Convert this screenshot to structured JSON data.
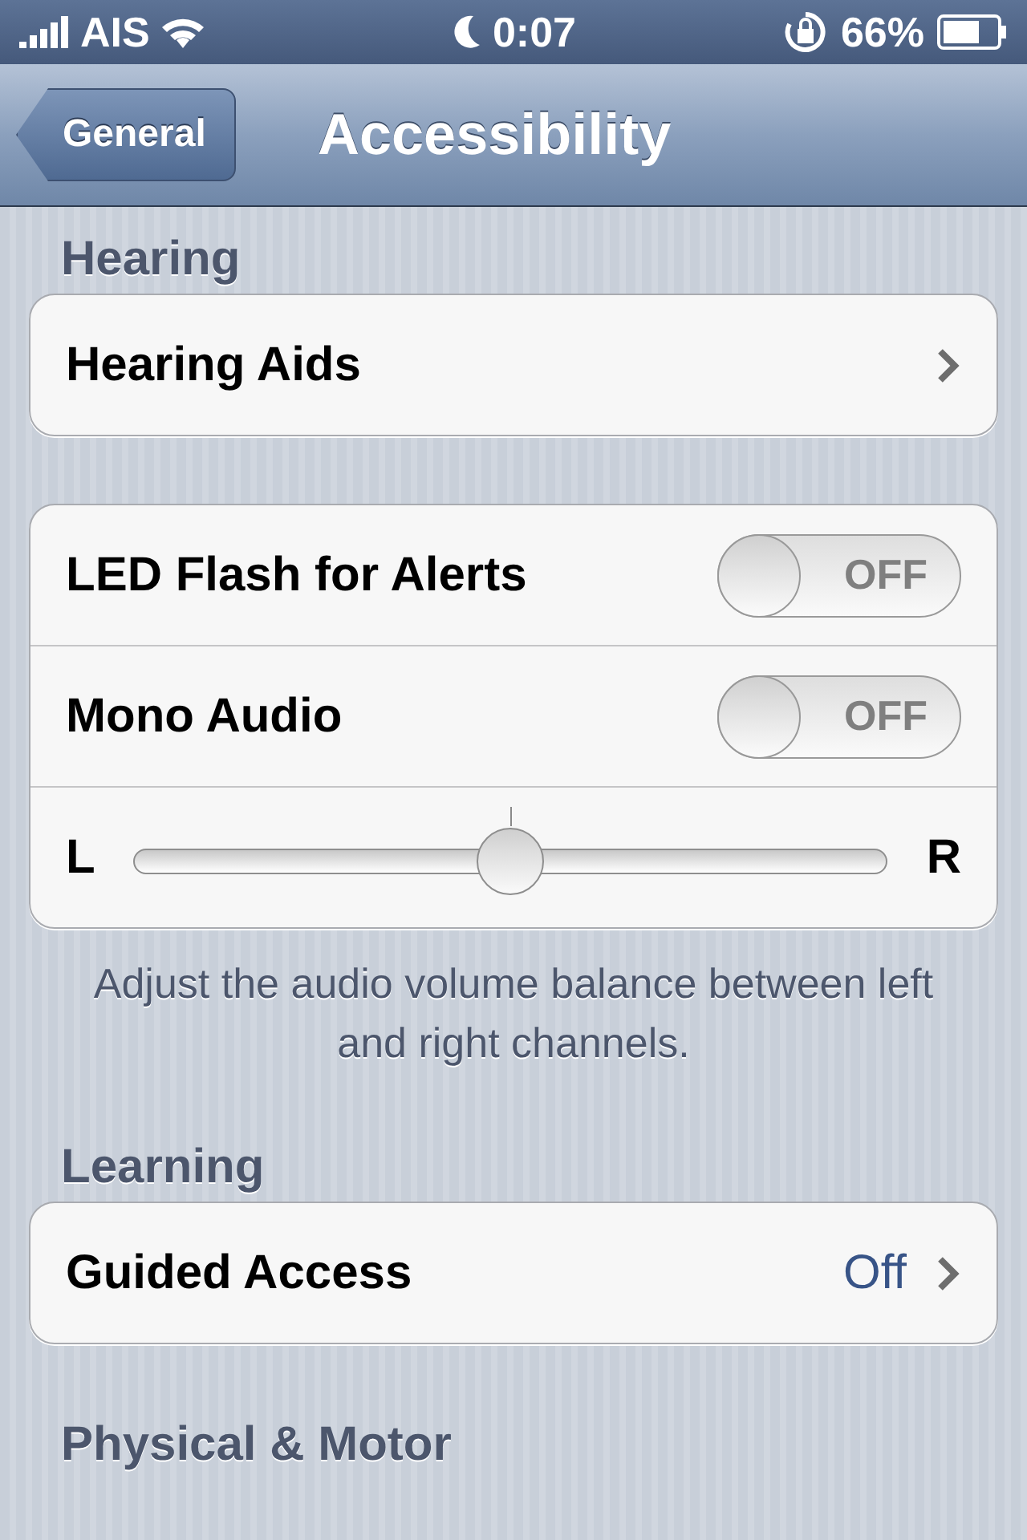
{
  "status_bar": {
    "carrier": "AIS",
    "time": "0:07",
    "battery": "66%"
  },
  "nav": {
    "back": "General",
    "title": "Accessibility"
  },
  "sections": [
    {
      "header": "Hearing",
      "groups": [
        [
          {
            "kind": "link",
            "label": "Hearing Aids"
          }
        ],
        [
          {
            "kind": "toggle",
            "label": "LED Flash for Alerts",
            "on": false,
            "state_text": "OFF"
          },
          {
            "kind": "toggle",
            "label": "Mono Audio",
            "on": false,
            "state_text": "OFF"
          },
          {
            "kind": "slider",
            "left_label": "L",
            "right_label": "R",
            "level": 0.5
          }
        ]
      ],
      "footer": "Adjust the audio volume balance between left and right channels."
    },
    {
      "header": "Learning",
      "groups": [
        [
          {
            "kind": "link",
            "label": "Guided Access",
            "value": "Off"
          }
        ]
      ]
    },
    {
      "header": "Physical & Motor"
    }
  ]
}
